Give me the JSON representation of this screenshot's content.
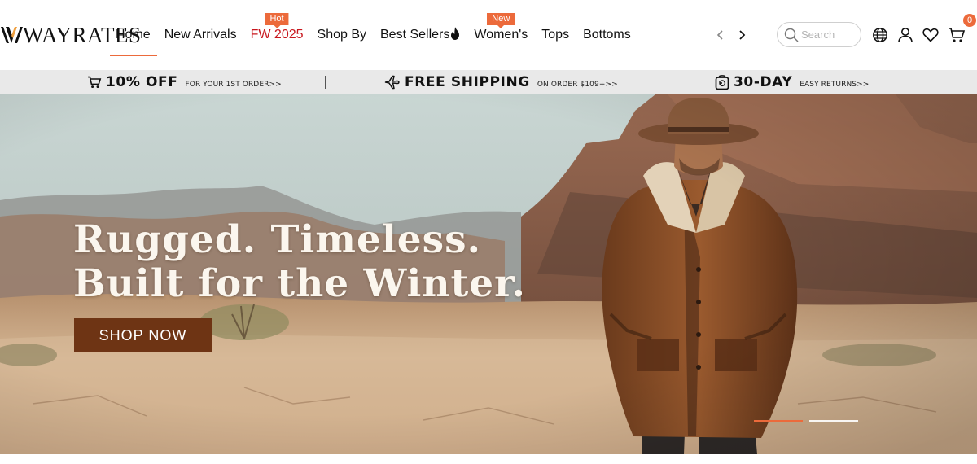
{
  "brand": {
    "name": "WAYRATES",
    "accent": "#ec6a3b"
  },
  "nav": [
    {
      "label": "Home",
      "active": true
    },
    {
      "label": "New Arrivals"
    },
    {
      "label": "FW 2025",
      "badge": "Hot",
      "color": "#c8161d"
    },
    {
      "label": "Shop By"
    },
    {
      "label": "Best Sellers",
      "icon": "flame-icon"
    },
    {
      "label": "Women's",
      "badge": "New"
    },
    {
      "label": "Tops"
    },
    {
      "label": "Bottoms"
    }
  ],
  "search": {
    "placeholder": "Search"
  },
  "header_icons": [
    "globe-icon",
    "user-icon",
    "heart-icon",
    "cart-icon"
  ],
  "cart": {
    "count": "0"
  },
  "promo": [
    {
      "icon": "cart-icon",
      "big": "10% OFF",
      "small": "FOR YOUR 1ST ORDER>>"
    },
    {
      "icon": "plane-icon",
      "big": "FREE SHIPPING",
      "small": "ON ORDER $109+>>"
    },
    {
      "icon": "return-bag-icon",
      "big": "30-DAY",
      "small": "EASY RETURNS>>"
    }
  ],
  "hero": {
    "headline_line1": "Rugged. Timeless.",
    "headline_line2": "Built for the Winter.",
    "cta": "SHOP NOW",
    "slides": 2,
    "active_slide": 1
  }
}
